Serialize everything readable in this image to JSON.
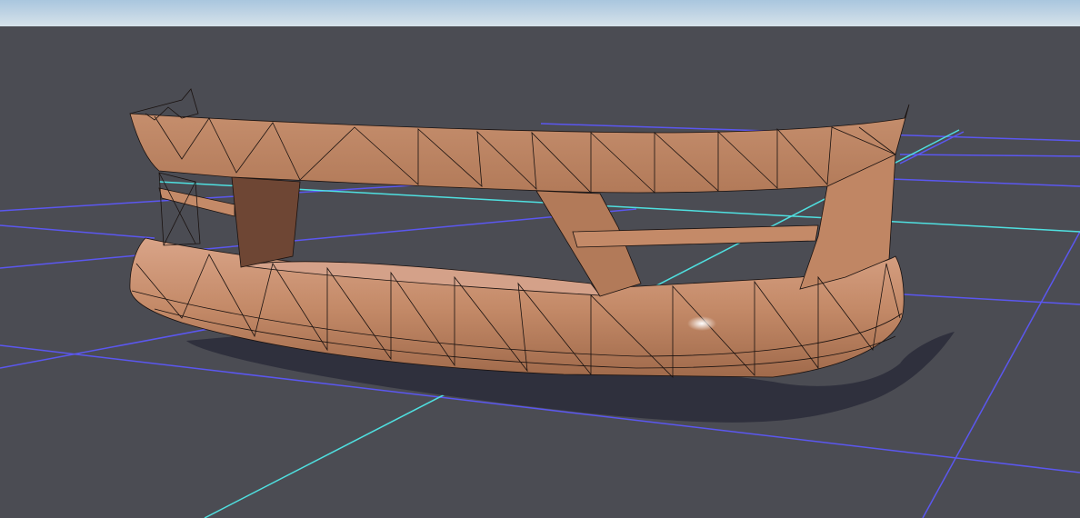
{
  "viewport": {
    "view": "3d-perspective",
    "object": "front-bumper-mesh",
    "display": "shaded-with-wireframe",
    "colors": {
      "sky_top": "#a9c6de",
      "sky_bottom": "#d6e2ea",
      "floor": "#4b4c53",
      "grid": "#5b57f0",
      "axis_x": "#4fe0e0",
      "mesh": "#c98f6e",
      "mesh_shade": "#a8704f",
      "wire": "#1a1210",
      "shadow": "#2f303d"
    }
  }
}
